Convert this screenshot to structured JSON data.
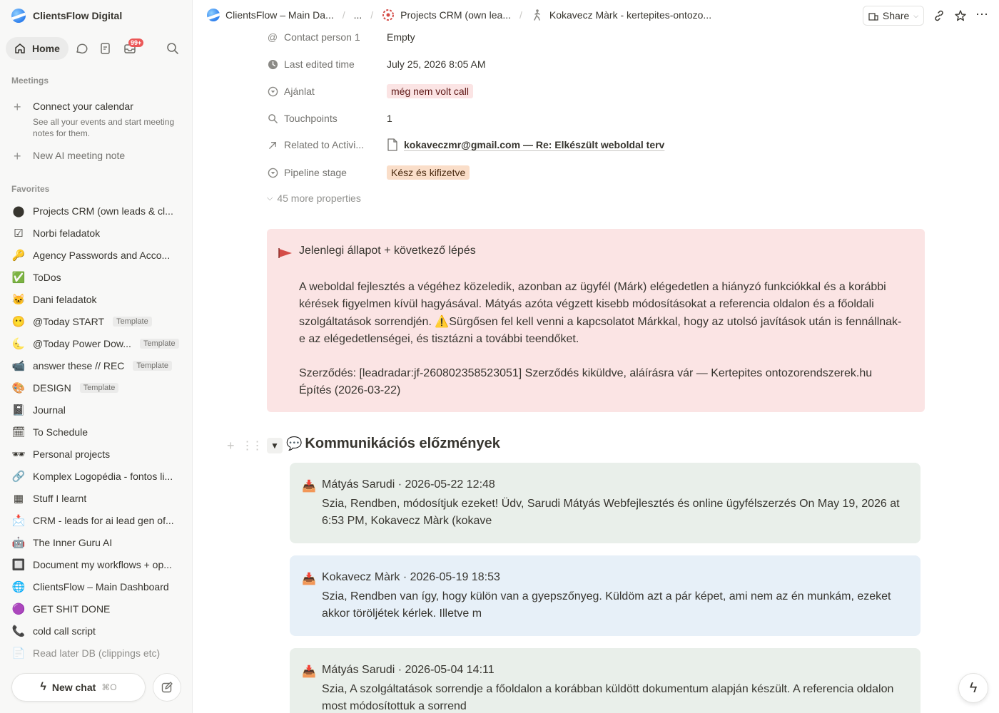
{
  "workspace": {
    "name": "ClientsFlow Digital"
  },
  "sidebar": {
    "home_label": "Home",
    "inbox_badge": "99+",
    "meetings_label": "Meetings",
    "connect_calendar_title": "Connect your calendar",
    "connect_calendar_sub": "See all your events and start meeting notes for them.",
    "new_ai_note": "New AI meeting note",
    "favorites_label": "Favorites",
    "favorites": [
      {
        "icon": "crm-icon",
        "glyph": "⬤",
        "label": "Projects CRM (own leads & cl...",
        "template": ""
      },
      {
        "icon": "checkbox-icon",
        "glyph": "☑",
        "label": "Norbi feladatok",
        "template": ""
      },
      {
        "icon": "key-icon",
        "glyph": "🔑",
        "label": "Agency Passwords and Acco...",
        "template": ""
      },
      {
        "icon": "check-mark-icon",
        "glyph": "✅",
        "label": "ToDos",
        "template": ""
      },
      {
        "icon": "cat-icon",
        "glyph": "🐱",
        "label": "Dani feladatok",
        "template": ""
      },
      {
        "icon": "smiley-icon",
        "glyph": "😶",
        "label": "@Today START",
        "template": "Template"
      },
      {
        "icon": "moon-icon",
        "glyph": "🌜",
        "label": "@Today Power Dow...",
        "template": "Template"
      },
      {
        "icon": "video-icon",
        "glyph": "📹",
        "label": "answer these // REC",
        "template": "Template"
      },
      {
        "icon": "palette-icon",
        "glyph": "🎨",
        "label": "DESIGN",
        "template": "Template"
      },
      {
        "icon": "notebook-icon",
        "glyph": "📓",
        "label": "Journal",
        "template": ""
      },
      {
        "icon": "schedule-icon",
        "glyph": "🗓",
        "label": "To Schedule",
        "template": ""
      },
      {
        "icon": "sunglasses-icon",
        "glyph": "🕶",
        "label": "Personal projects",
        "template": ""
      },
      {
        "icon": "link-icon",
        "glyph": "🔗",
        "label": "Komplex Logopédia - fontos li...",
        "template": ""
      },
      {
        "icon": "table-icon",
        "glyph": "▦",
        "label": "Stuff I learnt",
        "template": ""
      },
      {
        "icon": "inbox-tray-icon",
        "glyph": "📩",
        "label": "CRM - leads for ai lead gen of...",
        "template": ""
      },
      {
        "icon": "robot-icon",
        "glyph": "🤖",
        "label": "The Inner Guru AI",
        "template": ""
      },
      {
        "icon": "chip-icon",
        "glyph": "🔲",
        "label": "Document my workflows + op...",
        "template": ""
      },
      {
        "icon": "clientsflow-icon",
        "glyph": "🌐",
        "label": "ClientsFlow – Main Dashboard",
        "template": ""
      },
      {
        "icon": "focus-icon",
        "glyph": "🟣",
        "label": "GET SHIT DONE",
        "template": ""
      },
      {
        "icon": "phone-icon",
        "glyph": "📞",
        "label": "cold call script",
        "template": ""
      },
      {
        "icon": "clipboard-icon",
        "glyph": "📄",
        "label": "Read later DB (clippings etc)",
        "template": ""
      }
    ],
    "new_chat": "New chat",
    "new_chat_kbd": "⌘O"
  },
  "breadcrumbs": {
    "item1": "ClientsFlow – Main Da...",
    "ellipsis": "...",
    "item2": "Projects CRM (own lea...",
    "item3": "Kokavecz Màrk - kertepites-ontozo..."
  },
  "toolbar": {
    "share": "Share"
  },
  "properties": {
    "contact_person": {
      "name": "Contact person 1",
      "value": "Empty"
    },
    "last_edited": {
      "name": "Last edited time",
      "value": "July 25, 2026 8:05 AM"
    },
    "ajanlat": {
      "name": "Ajánlat",
      "value": "még nem volt call"
    },
    "touchpoints": {
      "name": "Touchpoints",
      "value": "1"
    },
    "related": {
      "name": "Related to Activi...",
      "value": "kokaveczmr@gmail.com — Re: Elkészült weboldal terv"
    },
    "pipeline": {
      "name": "Pipeline stage",
      "value": "Kész és kifizetve"
    },
    "more": "45 more properties"
  },
  "callout": {
    "title": "Jelenlegi állapot + következő lépés",
    "para1": "A weboldal fejlesztés a végéhez közeledik, azonban az ügyfél (Márk) elégedetlen a hiányzó funkciókkal és a korábbi kérések figyelmen kívül hagyásával. Mátyás azóta végzett kisebb módosításokat a referencia oldalon és a főoldali szolgáltatások sorrendjén. ⚠️Sürgősen fel kell venni a kapcsolatot Márkkal, hogy az utolsó javítások után is fennállnak-e az elégedetlenségei, és tisztázni a további teendőket.",
    "para2": "Szerződés: [leadradar:jf-260802358523051] Szerződés kiküldve, aláírásra vár — Kertepites ontozorendszerek.hu Építés (2026-03-22)"
  },
  "section": {
    "title": "Kommunikációs előzmények",
    "messages": [
      {
        "head": "Mátyás Sarudi · 2026-05-22 12:48",
        "body": "Szia, Rendben, módosítjuk ezeket! Üdv, Sarudi Mátyás Webfejlesztés és online ügyfélszerzés On May 19, 2026 at 6:53 PM, Kokavecz Màrk (kokave"
      },
      {
        "head": "Kokavecz Màrk · 2026-05-19 18:53",
        "body": "Szia, Rendben van így, hogy külön van a gyepszőnyeg. Küldöm azt a pár képet, ami nem az én munkám, ezeket akkor töröljétek kérlek. Illetve m"
      },
      {
        "head": "Mátyás Sarudi · 2026-05-04 14:11",
        "body": "Szia, A szolgáltatások sorrendje a főoldalon a korábban küldött dokumentum alapján készült. A referencia oldalon most módosítottuk a sorrend"
      }
    ]
  },
  "colors": {
    "callout_bg": "#fbe4e4",
    "msg_green": "#e9efea",
    "msg_blue": "#e7f0f8",
    "tag_red": "#fbe4e4",
    "tag_orange": "#fadec9"
  }
}
